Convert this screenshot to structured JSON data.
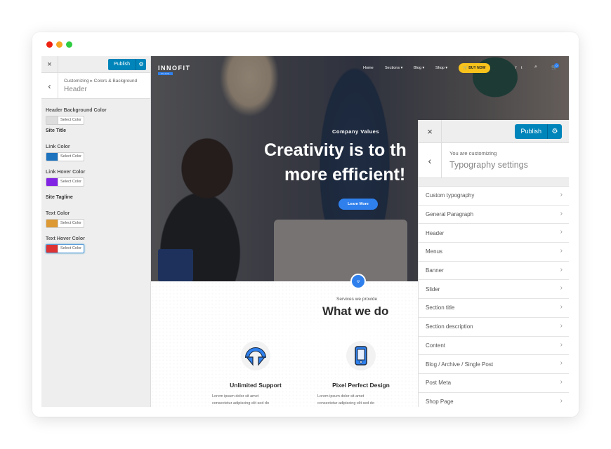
{
  "window": {
    "controls": [
      {
        "name": "close",
        "color": "#ee2211"
      },
      {
        "name": "minimize",
        "color": "#f5a623"
      },
      {
        "name": "maximize",
        "color": "#2ecc40"
      }
    ]
  },
  "left_customizer": {
    "close_icon": "×",
    "publish_label": "Publish",
    "gear_icon": "⚙",
    "back_icon": "‹",
    "breadcrumb": "Customizing ▸ Colors & Background",
    "title": "Header",
    "fields": [
      {
        "type": "color",
        "label": "Header Background Color",
        "button": "Select Color",
        "color": "#dddddd"
      },
      {
        "type": "section",
        "label": "Site Title"
      },
      {
        "type": "color",
        "label": "Link Color",
        "button": "Select Color",
        "color": "#1e73be"
      },
      {
        "type": "color",
        "label": "Link Hover Color",
        "button": "Select Color",
        "color": "#8224e3"
      },
      {
        "type": "section",
        "label": "Site Tagline"
      },
      {
        "type": "color",
        "label": "Text Color",
        "button": "Select Color",
        "color": "#dd9933"
      },
      {
        "type": "color",
        "label": "Text Hover Color",
        "button": "Select Color",
        "color": "#dd3333"
      }
    ]
  },
  "preview": {
    "logo": "INNOFIT",
    "logo_sub": "PLUS",
    "nav": [
      "Home",
      "Sections ▾",
      "Blog ▾",
      "Shop ▾"
    ],
    "buy_button": "🛒 BUY NOW",
    "social": [
      "f",
      "t"
    ],
    "search_icon": "⌕",
    "cart_count": "0",
    "hero": {
      "subtitle": "Company Values",
      "title_line1": "Creativity is to th",
      "title_line2": "more efficient!",
      "button": "Learn More"
    },
    "scroll_icon": "»",
    "services": {
      "subtitle": "Services we provide",
      "title": "What we do",
      "cards": [
        {
          "title": "Unlimited Support",
          "text_line1": "Lorem ipsum dolor sit amet",
          "text_line2": "consectetur adipiscing elit sed do",
          "icon": "headset"
        },
        {
          "title": "Pixel Perfect Design",
          "text_line1": "Lorem ipsum dolor sit amet",
          "text_line2": "consectetur adipiscing elit sed do",
          "icon": "smartphone"
        }
      ]
    },
    "accent": "#2f80ed"
  },
  "right_customizer": {
    "close_icon": "×",
    "publish_label": "Publish",
    "gear_icon": "⚙",
    "back_icon": "‹",
    "breadcrumb": "You are customizing",
    "title": "Typography settings",
    "chevron": "›",
    "items": [
      "Custom typography",
      "General Paragraph",
      "Header",
      "Menus",
      "Banner",
      "Slider",
      "Section title",
      "Section description",
      "Content",
      "Blog / Archive / Single Post",
      "Post Meta",
      "Shop Page"
    ]
  }
}
